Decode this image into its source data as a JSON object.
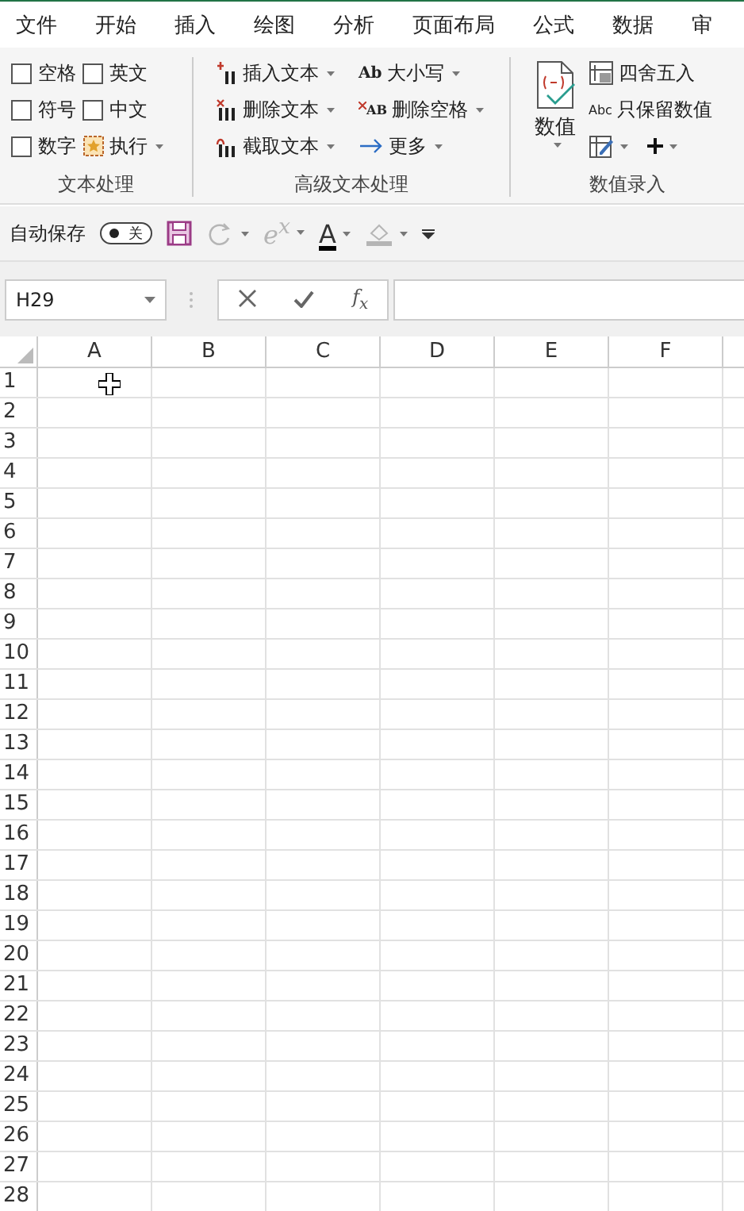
{
  "ribbon_tabs": [
    "文件",
    "开始",
    "插入",
    "绘图",
    "分析",
    "页面布局",
    "公式",
    "数据",
    "审"
  ],
  "ribbon_groups": [
    {
      "title": "文本处理",
      "columns": [
        [
          {
            "kind": "checkbox",
            "label": "空格",
            "checked": false
          },
          {
            "kind": "checkbox",
            "label": "符号",
            "checked": false
          },
          {
            "kind": "checkbox",
            "label": "数字",
            "checked": false
          }
        ],
        [
          {
            "kind": "checkbox",
            "label": "英文",
            "checked": false
          },
          {
            "kind": "checkbox",
            "label": "中文",
            "checked": false
          },
          {
            "kind": "star",
            "label": "执行",
            "dropdown": true
          }
        ]
      ]
    },
    {
      "title": "高级文本处理",
      "columns": [
        [
          {
            "kind": "insert",
            "label": "插入文本",
            "dropdown": true
          },
          {
            "kind": "delete",
            "label": "删除文本",
            "dropdown": true
          },
          {
            "kind": "cut",
            "label": "截取文本",
            "dropdown": true
          }
        ],
        [
          {
            "kind": "glyph",
            "icon_text": "Ab",
            "label": "大小写",
            "dropdown": true
          },
          {
            "kind": "delglyph",
            "icon_text": "AB",
            "label": "删除空格",
            "dropdown": true
          },
          {
            "kind": "arrow",
            "label": "更多",
            "dropdown": true
          }
        ]
      ]
    },
    {
      "title": "数值录入",
      "big": {
        "label": "数值",
        "dropdown": true
      },
      "columns": [
        [
          {
            "kind": "round",
            "label": "四舍五入"
          },
          {
            "kind": "abc",
            "icon_text": "Abc",
            "label": "只保留数值"
          },
          {
            "kind": "pair"
          }
        ]
      ]
    }
  ],
  "quick_access": {
    "autosave_label": "自动保存",
    "autosave": {
      "label": "关",
      "on": false
    },
    "tools": [
      {
        "kind": "save",
        "disabled": false
      },
      {
        "kind": "redo",
        "disabled": true,
        "dropdown": true
      },
      {
        "kind": "power",
        "label": "e$^{x}$",
        "disabled": true,
        "dropdown": true
      },
      {
        "kind": "fontcolor",
        "label": "A",
        "disabled": false,
        "dropdown": true
      },
      {
        "kind": "fill",
        "disabled": true,
        "dropdown": true
      },
      {
        "kind": "customize",
        "disabled": false
      }
    ]
  },
  "formula_bar": {
    "name_box": "H29",
    "function_label": "f$_{x}$"
  },
  "sheet": {
    "columns": [
      "A",
      "B",
      "C",
      "D",
      "E",
      "F"
    ],
    "rows": [
      "1",
      "2",
      "3",
      "4",
      "5",
      "6",
      "7",
      "8",
      "9",
      "10",
      "11",
      "12",
      "13",
      "14",
      "15",
      "16",
      "17",
      "18",
      "19",
      "20",
      "21",
      "22",
      "23",
      "24",
      "25",
      "26",
      "27",
      "28"
    ]
  }
}
